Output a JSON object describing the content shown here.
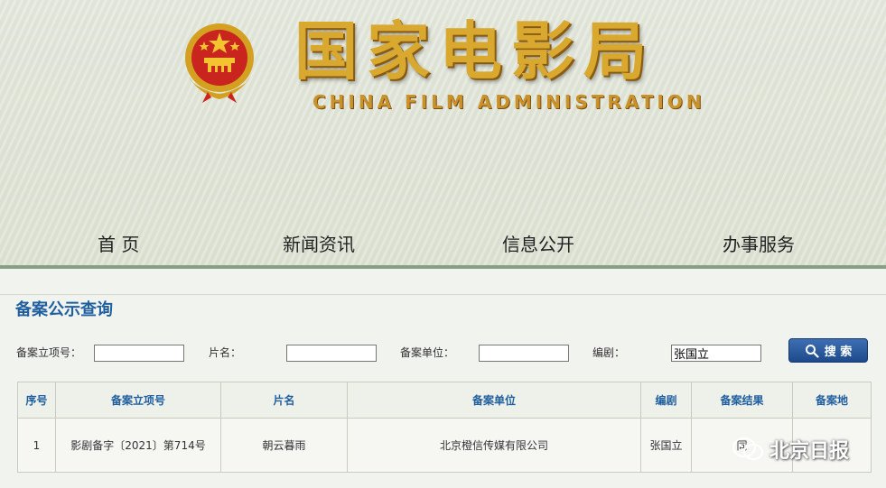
{
  "header": {
    "title_cn": "国家电影局",
    "title_en": "CHINA FILM ADMINISTRATION"
  },
  "nav": {
    "items": [
      {
        "label": "首 页"
      },
      {
        "label": "新闻资讯"
      },
      {
        "label": "信息公开"
      },
      {
        "label": "办事服务"
      }
    ]
  },
  "search": {
    "section_title": "备案公示查询",
    "fields": [
      {
        "label": "备案立项号：",
        "value": ""
      },
      {
        "label": "片名：",
        "value": ""
      },
      {
        "label": "备案单位：",
        "value": ""
      },
      {
        "label": "编剧：",
        "value": "张国立"
      }
    ],
    "button_label": "搜 索"
  },
  "table": {
    "headers": [
      "序号",
      "备案立项号",
      "片名",
      "备案单位",
      "编剧",
      "备案结果",
      "备案地"
    ],
    "rows": [
      [
        "1",
        "影剧备字〔2021〕第714号",
        "朝云暮雨",
        "北京橙信传媒有限公司",
        "张国立",
        "同",
        ""
      ]
    ]
  },
  "watermark": {
    "text": "北京日报"
  },
  "colors": {
    "accent_blue": "#1f5f9f",
    "title_gold": "#d9a82e",
    "nav_bar": "#8a9e83"
  }
}
